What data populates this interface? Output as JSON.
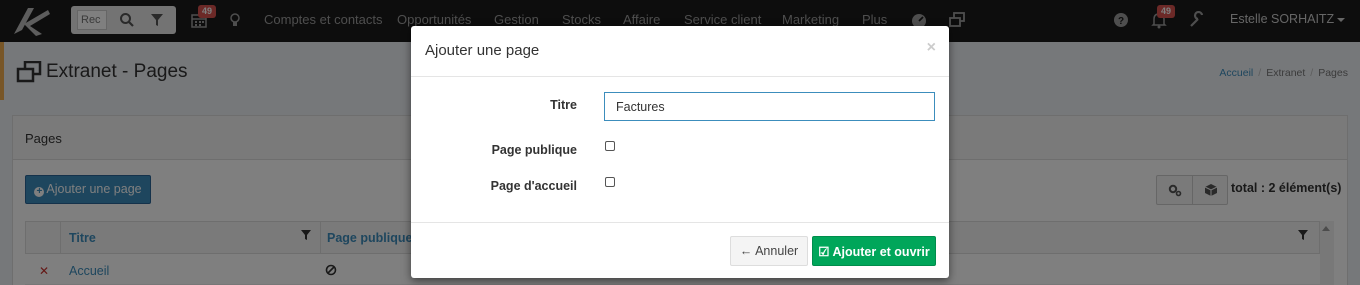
{
  "navbar": {
    "search_placeholder": "Rec",
    "calendar_badge": "49",
    "items": [
      "Comptes et contacts",
      "Opportunités",
      "Gestion",
      "Stocks",
      "Affaire",
      "Service client",
      "Marketing",
      "Plus"
    ],
    "notification_badge": "49",
    "user_name": "Estelle SORHAITZ"
  },
  "page": {
    "title": "Extranet - Pages",
    "breadcrumb": [
      "Accueil",
      "Extranet",
      "Pages"
    ]
  },
  "box": {
    "title": "Pages",
    "add_button": "Ajouter une page",
    "total": "total : 2 élément(s)"
  },
  "table": {
    "columns": [
      "Titre",
      "Page publique"
    ],
    "rows": [
      {
        "title": "Accueil"
      }
    ]
  },
  "modal": {
    "title": "Ajouter une page",
    "close": "×",
    "fields": {
      "title_label": "Titre",
      "title_value": "Factures",
      "public_label": "Page publique",
      "home_label": "Page d'accueil"
    },
    "cancel_button": "Annuler",
    "submit_button": "Ajouter et ouvrir"
  },
  "colors": {
    "navbar": "#1a1a1a",
    "primary": "#3c8dbc",
    "success": "#00a65a",
    "danger": "#d9534f",
    "accent": "#f0ad4e"
  }
}
